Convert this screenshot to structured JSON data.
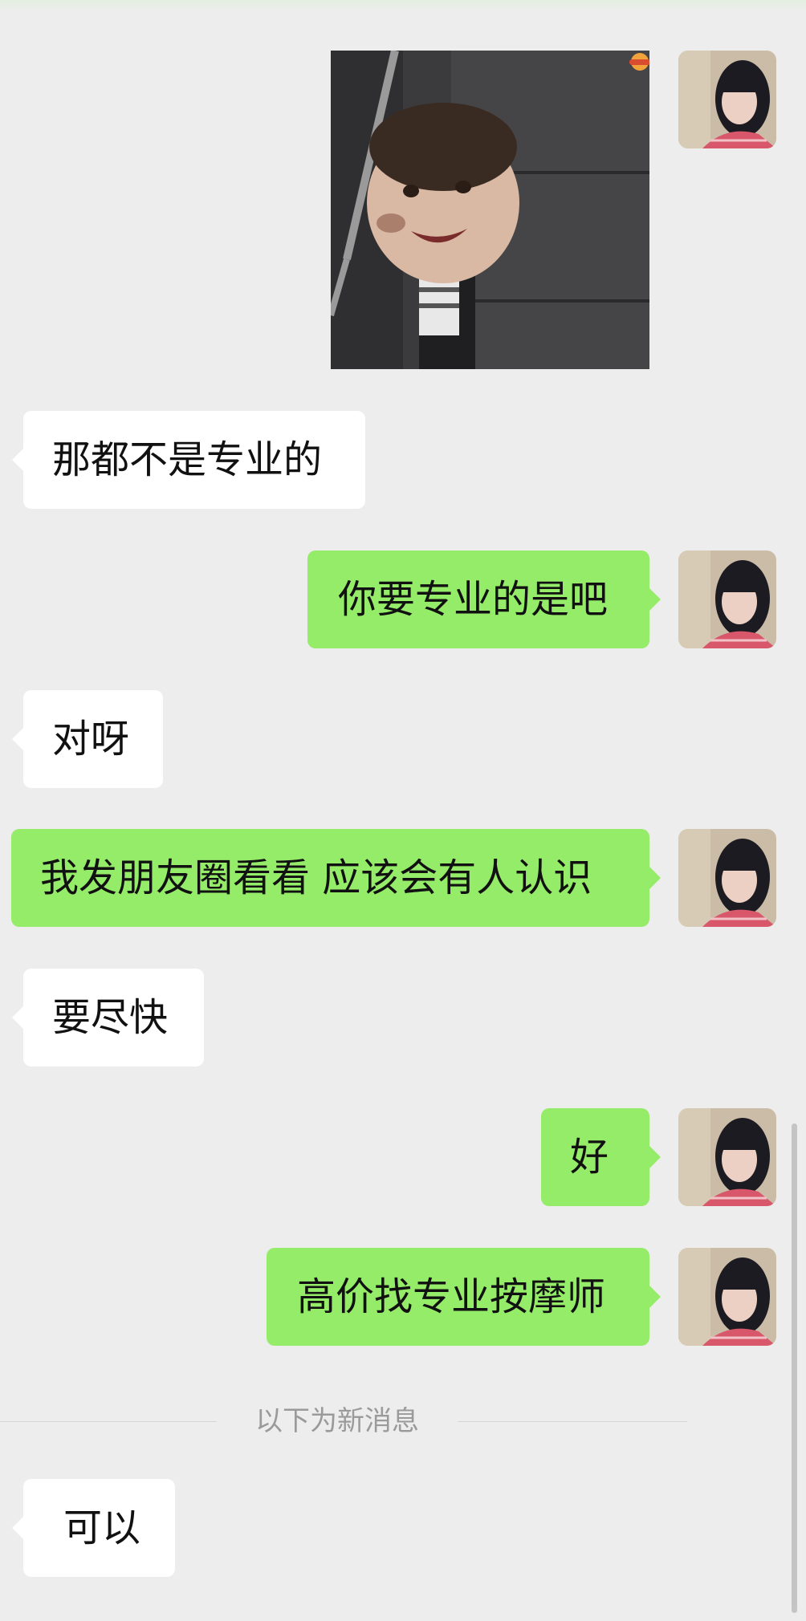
{
  "messages": [
    {
      "sender": "me",
      "type": "sticker"
    },
    {
      "sender": "other",
      "type": "text",
      "text": "那都不是专业的"
    },
    {
      "sender": "me",
      "type": "text",
      "text": "你要专业的是吧"
    },
    {
      "sender": "other",
      "type": "text",
      "text": "对呀"
    },
    {
      "sender": "me",
      "type": "text",
      "text": "我发朋友圈看看 应该会有人认识"
    },
    {
      "sender": "other",
      "type": "text",
      "text": "要尽快"
    },
    {
      "sender": "me",
      "type": "text",
      "text": "好"
    },
    {
      "sender": "me",
      "type": "text",
      "text": "高价找专业按摩师"
    },
    {
      "sender": "other",
      "type": "text",
      "text": "可以"
    }
  ],
  "new_messages_divider": "以下为新消息",
  "colors": {
    "background": "#ededed",
    "outgoing_bubble": "#95ec69",
    "incoming_bubble": "#ffffff",
    "divider_text": "#9a9a9a"
  },
  "icons": {
    "sticker_badge": "hotdog-icon"
  }
}
